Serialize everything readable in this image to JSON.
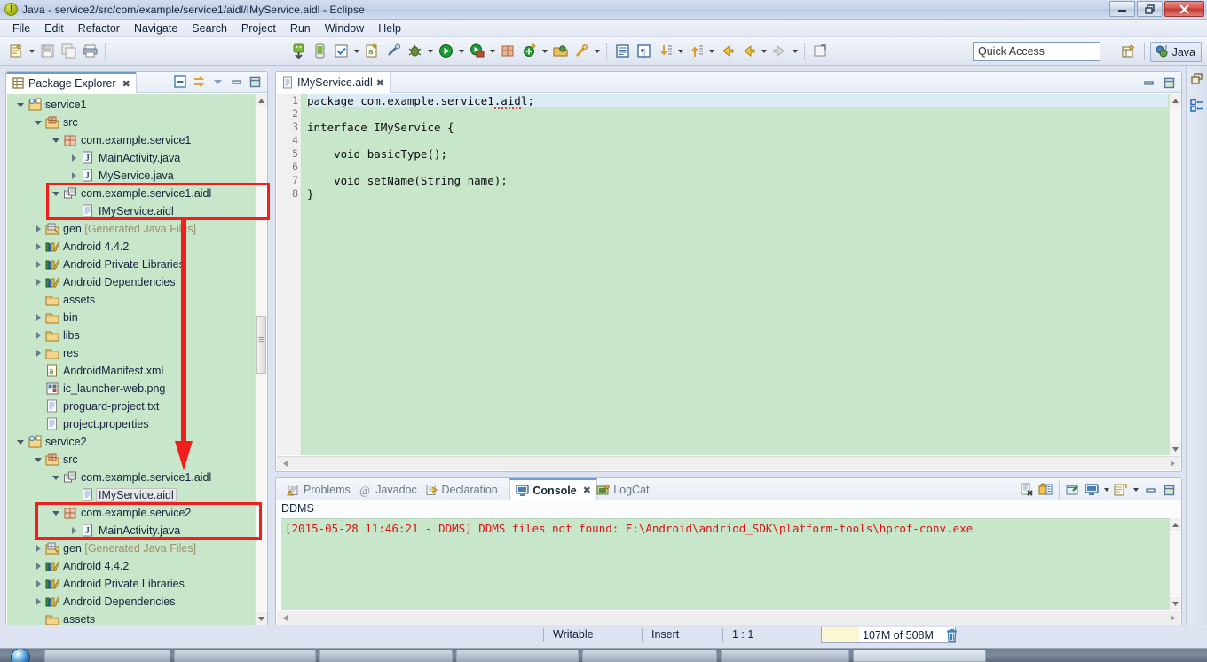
{
  "window": {
    "title": "Java - service2/src/com/example/service1/aidl/IMyService.aidl - Eclipse",
    "app_icon": "eclipse-icon",
    "minimize_label": "minimize-icon",
    "maximize_label": "restore-icon",
    "close_label": "close-icon"
  },
  "menubar": {
    "items": [
      {
        "label": "File"
      },
      {
        "label": "Edit"
      },
      {
        "label": "Refactor"
      },
      {
        "label": "Navigate"
      },
      {
        "label": "Search"
      },
      {
        "label": "Project"
      },
      {
        "label": "Run"
      },
      {
        "label": "Window"
      },
      {
        "label": "Help"
      }
    ]
  },
  "toolbar": {
    "icons": [
      {
        "name": "new-wizard-icon"
      },
      {
        "name": "new-dropdown-caret"
      },
      {
        "name": "save-icon"
      },
      {
        "name": "save-all-icon"
      },
      {
        "name": "print-icon"
      },
      {
        "name": "android-sdk-manager-icon"
      },
      {
        "name": "android-avd-manager-icon"
      },
      {
        "name": "lint-check-icon"
      },
      {
        "name": "lint-dropdown-caret"
      },
      {
        "name": "new-android-xml-icon"
      },
      {
        "name": "disable-breakpoints-icon"
      },
      {
        "name": "debug-icon"
      },
      {
        "name": "debug-dropdown-caret"
      },
      {
        "name": "run-icon"
      },
      {
        "name": "run-dropdown-caret"
      },
      {
        "name": "external-tools-icon"
      },
      {
        "name": "external-tools-dropdown-caret"
      },
      {
        "name": "new-java-package-icon"
      },
      {
        "name": "new-java-class-icon"
      },
      {
        "name": "new-class-dropdown-caret"
      },
      {
        "name": "open-type-icon"
      },
      {
        "name": "search-icon"
      },
      {
        "name": "search-dropdown-caret"
      },
      {
        "name": "toggle-block-selection-icon"
      },
      {
        "name": "show-whitespace-icon"
      },
      {
        "name": "next-annotation-icon"
      },
      {
        "name": "next-annotation-caret"
      },
      {
        "name": "previous-annotation-icon"
      },
      {
        "name": "previous-annotation-caret"
      },
      {
        "name": "back-icon"
      },
      {
        "name": "forward-icon"
      },
      {
        "name": "forward-caret"
      },
      {
        "name": "next-edit-icon"
      },
      {
        "name": "next-edit-caret"
      },
      {
        "name": "open-task-icon"
      }
    ],
    "quick_access_placeholder": "Quick Access",
    "perspective_add_icon": "open-perspective-icon",
    "perspective_current": "Java",
    "perspective_icon": "java-perspective-icon"
  },
  "package_explorer": {
    "tab_label": "Package Explorer",
    "tab_icon": "package-explorer-icon",
    "tab_close_icon": "close-icon",
    "toolbar": [
      {
        "name": "collapse-all-icon"
      },
      {
        "name": "link-with-editor-icon"
      },
      {
        "name": "view-menu-icon"
      },
      {
        "name": "minimize-view-icon"
      },
      {
        "name": "maximize-view-icon"
      }
    ],
    "tree": [
      {
        "indent": 0,
        "twisty": "open",
        "icon": "android-project-icon",
        "label": "service1",
        "dim": ""
      },
      {
        "indent": 1,
        "twisty": "open",
        "icon": "source-folder-icon",
        "label": "src",
        "dim": ""
      },
      {
        "indent": 2,
        "twisty": "open",
        "icon": "package-icon",
        "label": "com.example.service1",
        "dim": ""
      },
      {
        "indent": 3,
        "twisty": "closed",
        "icon": "java-file-icon",
        "label": "MainActivity.java",
        "dim": ""
      },
      {
        "indent": 3,
        "twisty": "closed",
        "icon": "java-file-icon",
        "label": "MyService.java",
        "dim": ""
      },
      {
        "indent": 2,
        "twisty": "open",
        "icon": "aidl-package-icon",
        "label": "com.example.service1.aidl",
        "dim": ""
      },
      {
        "indent": 3,
        "twisty": "none",
        "icon": "file-icon",
        "label": "IMyService.aidl",
        "dim": ""
      },
      {
        "indent": 1,
        "twisty": "closed",
        "icon": "gen-folder-icon",
        "label": "gen ",
        "dim": "[Generated Java Files]"
      },
      {
        "indent": 1,
        "twisty": "closed",
        "icon": "library-icon",
        "label": "Android 4.4.2",
        "dim": ""
      },
      {
        "indent": 1,
        "twisty": "closed",
        "icon": "library-icon",
        "label": "Android Private Libraries",
        "dim": ""
      },
      {
        "indent": 1,
        "twisty": "closed",
        "icon": "library-icon",
        "label": "Android Dependencies",
        "dim": ""
      },
      {
        "indent": 1,
        "twisty": "none",
        "icon": "folder-icon",
        "label": "assets",
        "dim": ""
      },
      {
        "indent": 1,
        "twisty": "closed",
        "icon": "folder-icon",
        "label": "bin",
        "dim": ""
      },
      {
        "indent": 1,
        "twisty": "closed",
        "icon": "folder-icon",
        "label": "libs",
        "dim": ""
      },
      {
        "indent": 1,
        "twisty": "closed",
        "icon": "folder-icon",
        "label": "res",
        "dim": ""
      },
      {
        "indent": 1,
        "twisty": "none",
        "icon": "xml-file-icon",
        "label": "AndroidManifest.xml",
        "dim": ""
      },
      {
        "indent": 1,
        "twisty": "none",
        "icon": "png-file-icon",
        "label": "ic_launcher-web.png",
        "dim": ""
      },
      {
        "indent": 1,
        "twisty": "none",
        "icon": "file-icon",
        "label": "proguard-project.txt",
        "dim": ""
      },
      {
        "indent": 1,
        "twisty": "none",
        "icon": "file-icon",
        "label": "project.properties",
        "dim": ""
      },
      {
        "indent": 0,
        "twisty": "open",
        "icon": "android-project-icon",
        "label": "service2",
        "dim": ""
      },
      {
        "indent": 1,
        "twisty": "open",
        "icon": "source-folder-icon",
        "label": "src",
        "dim": ""
      },
      {
        "indent": 2,
        "twisty": "open",
        "icon": "aidl-package-icon",
        "label": "com.example.service1.aidl",
        "dim": ""
      },
      {
        "indent": 3,
        "twisty": "none",
        "icon": "file-icon",
        "label": "IMyService.aidl",
        "dim": "",
        "selected": true
      },
      {
        "indent": 2,
        "twisty": "open",
        "icon": "package-icon",
        "label": "com.example.service2",
        "dim": ""
      },
      {
        "indent": 3,
        "twisty": "closed",
        "icon": "java-file-icon",
        "label": "MainActivity.java",
        "dim": ""
      },
      {
        "indent": 1,
        "twisty": "closed",
        "icon": "gen-folder-icon",
        "label": "gen ",
        "dim": "[Generated Java Files]"
      },
      {
        "indent": 1,
        "twisty": "closed",
        "icon": "library-icon",
        "label": "Android 4.4.2",
        "dim": ""
      },
      {
        "indent": 1,
        "twisty": "closed",
        "icon": "library-icon",
        "label": "Android Private Libraries",
        "dim": ""
      },
      {
        "indent": 1,
        "twisty": "closed",
        "icon": "library-icon",
        "label": "Android Dependencies",
        "dim": ""
      },
      {
        "indent": 1,
        "twisty": "none",
        "icon": "folder-icon",
        "label": "assets",
        "dim": ""
      }
    ]
  },
  "editor": {
    "tab_label": "IMyService.aidl",
    "tab_icon": "file-icon",
    "tab_close_icon": "close-icon",
    "minimize_icon": "minimize-view-icon",
    "maximize_icon": "maximize-view-icon",
    "line_numbers": [
      "1",
      "2",
      "3",
      "4",
      "5",
      "6",
      "7",
      "8"
    ],
    "lines": [
      {
        "text": "package com.example.service1.aidl;",
        "current": true,
        "squiggle_from": 28,
        "squiggle_to": 32
      },
      {
        "text": "",
        "current": false
      },
      {
        "text": "interface IMyService {",
        "current": false
      },
      {
        "text": "",
        "current": false
      },
      {
        "text": "    void basicType();",
        "current": false
      },
      {
        "text": "",
        "current": false
      },
      {
        "text": "    void setName(String name);",
        "current": false
      },
      {
        "text": "}",
        "current": false
      }
    ]
  },
  "console": {
    "tabs": [
      {
        "label": "Problems",
        "icon": "problems-icon",
        "active": false
      },
      {
        "label": "Javadoc",
        "icon": "javadoc-icon",
        "active": false
      },
      {
        "label": "Declaration",
        "icon": "declaration-icon",
        "active": false
      },
      {
        "label": "Console",
        "icon": "console-icon",
        "active": true,
        "close_icon": "close-icon"
      },
      {
        "label": "LogCat",
        "icon": "logcat-icon",
        "active": false
      }
    ],
    "toolbar": [
      {
        "name": "clear-console-icon"
      },
      {
        "name": "scroll-lock-icon"
      },
      {
        "name": "pin-console-icon"
      },
      {
        "name": "display-selected-console-icon"
      },
      {
        "name": "display-console-caret"
      },
      {
        "name": "open-console-icon"
      },
      {
        "name": "open-console-caret"
      },
      {
        "name": "minimize-view-icon"
      },
      {
        "name": "maximize-view-icon"
      }
    ],
    "title": "DDMS",
    "output_line": "[2015-05-28 11:46:21 - DDMS] DDMS files not found: F:\\Android\\andriod_SDK\\platform-tools\\hprof-conv.exe",
    "output_color": "#d81515"
  },
  "statusbar": {
    "writable": "Writable",
    "insert_mode": "Insert",
    "position": "1 : 1",
    "memory": "107M of 508M",
    "trash_icon": "garbage-collect-icon"
  },
  "rightbar": {
    "icons": [
      {
        "name": "restore-perspective-icon"
      },
      {
        "name": "package-explorer-fastview-icon"
      }
    ]
  },
  "annotations": {
    "box1_label": "highlight-aidl-package-service1",
    "box2_label": "highlight-package-service2",
    "arrow_label": "copy-aidl-arrow",
    "color": "#f21d1d"
  },
  "taskbar": {
    "start_icon": "windows-start-orb",
    "items": [
      {
        "name": "taskbar-item-1"
      },
      {
        "name": "taskbar-item-2"
      },
      {
        "name": "taskbar-item-3"
      },
      {
        "name": "taskbar-item-4"
      },
      {
        "name": "taskbar-item-5"
      },
      {
        "name": "taskbar-item-6"
      },
      {
        "name": "taskbar-item-7"
      }
    ]
  }
}
